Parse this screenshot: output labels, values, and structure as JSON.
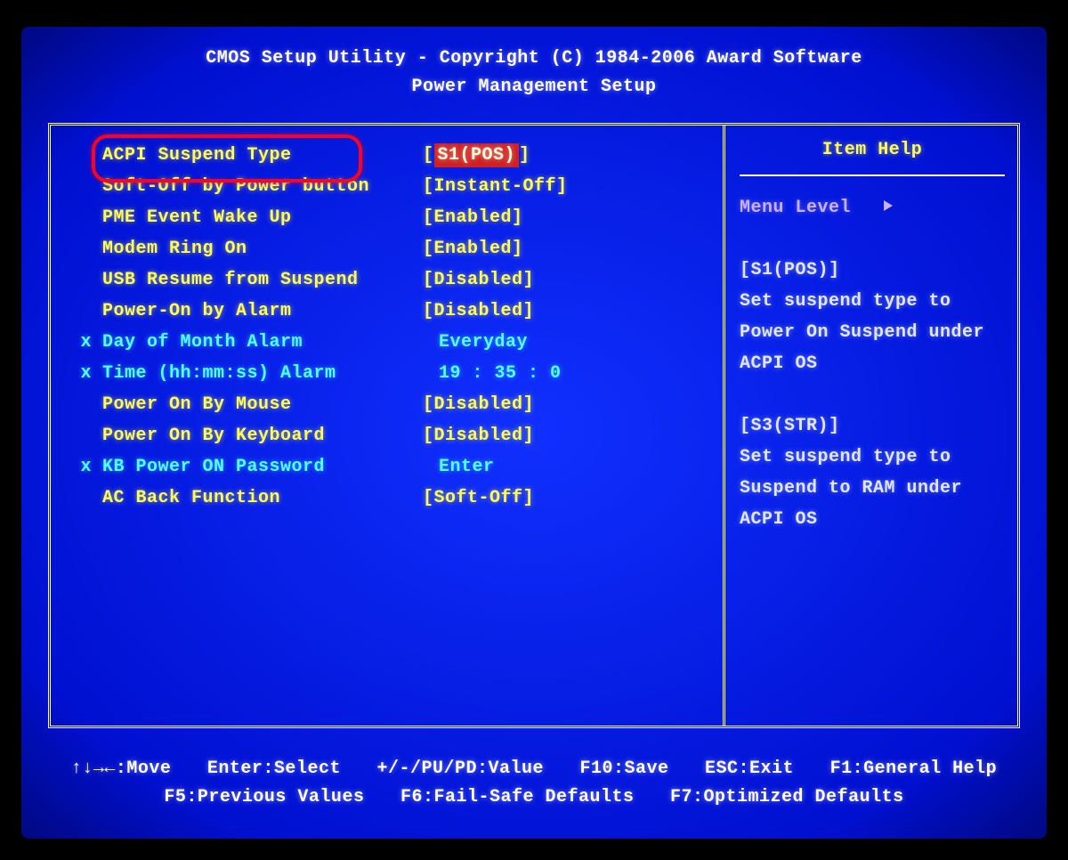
{
  "header": {
    "title": "CMOS Setup Utility - Copyright (C) 1984-2006 Award Software",
    "subtitle": "Power Management Setup"
  },
  "settings": [
    {
      "mark": "",
      "label": "ACPI Suspend Type",
      "value": "[S1(POS)]",
      "style": "selected"
    },
    {
      "mark": "",
      "label": "Soft-Off by Power button",
      "value": "[Instant-Off]",
      "style": "yellow"
    },
    {
      "mark": "",
      "label": "PME Event Wake Up",
      "value": "[Enabled]",
      "style": "yellow"
    },
    {
      "mark": "",
      "label": "Modem Ring On",
      "value": "[Enabled]",
      "style": "yellow"
    },
    {
      "mark": "",
      "label": "USB Resume from Suspend",
      "value": "[Disabled]",
      "style": "yellow"
    },
    {
      "mark": "",
      "label": "Power-On by Alarm",
      "value": "[Disabled]",
      "style": "yellow"
    },
    {
      "mark": "x",
      "label": "Day of Month Alarm",
      "value": "Everyday",
      "style": "cyan"
    },
    {
      "mark": "x",
      "label": "Time (hh:mm:ss) Alarm",
      "value": "19 : 35 :  0",
      "style": "cyan"
    },
    {
      "mark": "",
      "label": "Power On By Mouse",
      "value": "[Disabled]",
      "style": "yellow"
    },
    {
      "mark": "",
      "label": "Power On By Keyboard",
      "value": "[Disabled]",
      "style": "yellow"
    },
    {
      "mark": "x",
      "label": "KB Power ON Password",
      "value": "Enter",
      "style": "cyan"
    },
    {
      "mark": "",
      "label": "AC Back Function",
      "value": "[Soft-Off]",
      "style": "yellow"
    }
  ],
  "help": {
    "title": "Item Help",
    "menu_level": "Menu Level",
    "lines": [
      "[S1(POS)]",
      "Set suspend type to",
      "Power On Suspend under",
      "ACPI OS",
      "",
      "[S3(STR)]",
      "Set suspend type to",
      "Suspend to RAM under",
      "ACPI OS"
    ]
  },
  "footer": {
    "row1": {
      "move": "↑↓→←:Move",
      "select": "Enter:Select",
      "value": "+/-/PU/PD:Value",
      "save": "F10:Save",
      "exit": "ESC:Exit",
      "help": "F1:General Help"
    },
    "row2": {
      "prev": "F5:Previous Values",
      "failsafe": "F6:Fail-Safe Defaults",
      "optimized": "F7:Optimized Defaults"
    }
  }
}
